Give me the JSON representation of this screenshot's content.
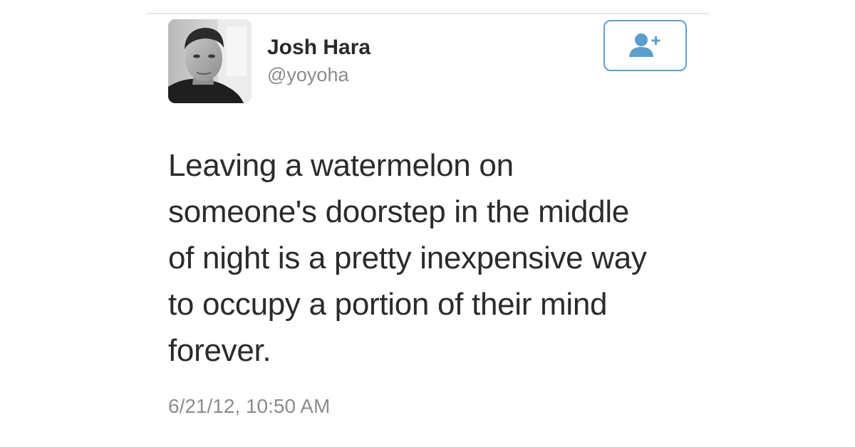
{
  "tweet": {
    "author": {
      "name": "Josh Hara",
      "handle": "@yoyoha"
    },
    "text_lines": [
      "Leaving a watermelon on",
      "someone's doorstep in the middle",
      "of night is a pretty inexpensive way",
      "to occupy a portion of their mind",
      "forever."
    ],
    "timestamp": "6/21/12, 10:50 AM",
    "follow_icon": "add-user-icon"
  },
  "colors": {
    "accent": "#5b9fcc",
    "text": "#2b2b2b",
    "muted": "#8a8a8a"
  }
}
